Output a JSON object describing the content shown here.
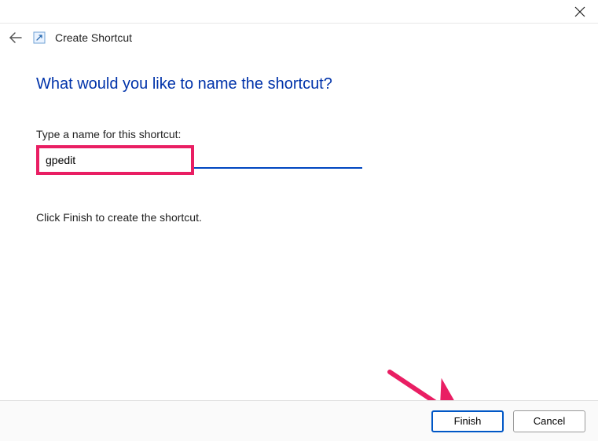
{
  "titlebar": {
    "close_label": "Close"
  },
  "header": {
    "back_label": "Back",
    "icon_label": "shortcut",
    "window_title": "Create Shortcut"
  },
  "content": {
    "heading": "What would you like to name the shortcut?",
    "prompt_label": "Type a name for this shortcut:",
    "input_value": "gpedit",
    "helper_text": "Click Finish to create the shortcut."
  },
  "footer": {
    "finish_label": "Finish",
    "cancel_label": "Cancel"
  }
}
